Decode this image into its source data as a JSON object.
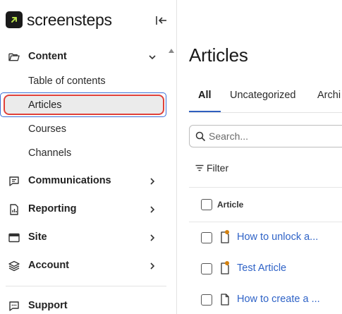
{
  "app": {
    "logo_text": "screensteps",
    "accent_color": "#2f5fbf",
    "logo_arrow_color": "#b8e04a"
  },
  "sidebar": {
    "sections": [
      {
        "label": "Content",
        "icon": "folder-icon",
        "expanded": true
      },
      {
        "label": "Communications",
        "icon": "message-icon",
        "expanded": false
      },
      {
        "label": "Reporting",
        "icon": "report-icon",
        "expanded": false
      },
      {
        "label": "Site",
        "icon": "browser-icon",
        "expanded": false
      },
      {
        "label": "Account",
        "icon": "layers-icon",
        "expanded": false
      }
    ],
    "content_items": [
      {
        "label": "Table of contents"
      },
      {
        "label": "Articles",
        "active": true
      },
      {
        "label": "Courses"
      },
      {
        "label": "Channels"
      }
    ],
    "support_label": "Support"
  },
  "main": {
    "title": "Articles",
    "tabs": [
      {
        "label": "All",
        "active": true
      },
      {
        "label": "Uncategorized"
      },
      {
        "label": "Archi"
      }
    ],
    "search_placeholder": "Search...",
    "filter_label": "Filter",
    "table": {
      "column_header": "Article",
      "rows": [
        {
          "title": "How to unlock a...",
          "status_dot": true
        },
        {
          "title": "Test Article",
          "status_dot": true
        },
        {
          "title": "How to create a ...",
          "status_dot": false
        }
      ]
    }
  }
}
